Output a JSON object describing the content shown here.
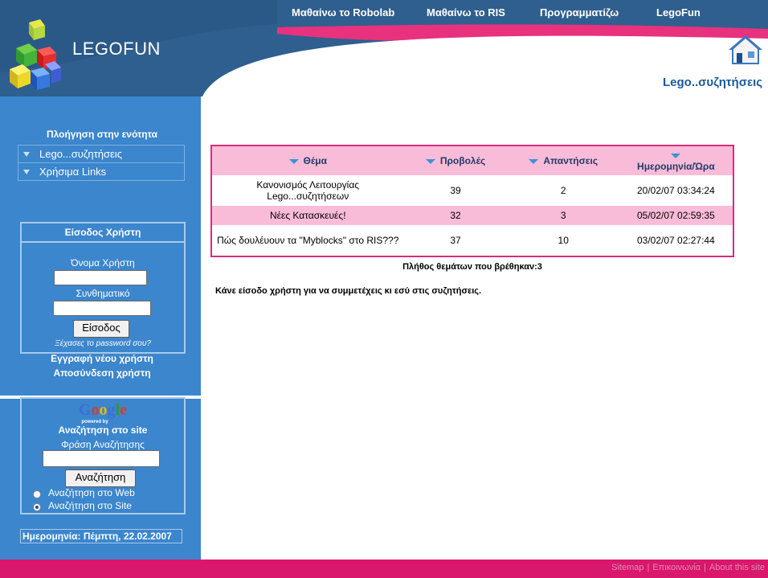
{
  "header": {
    "logo_text": "LEGOFUN",
    "nav": [
      "Μαθαίνω το Robolab",
      "Μαθαίνω το RIS",
      "Προγραμματίζω",
      "LegoFun"
    ],
    "breadcrumb": "Lego..συζητήσεις"
  },
  "sidebar": {
    "nav_title": "Πλοήγηση στην ενότητα",
    "nav_items": [
      "Lego...συζητήσεις",
      "Χρήσιμα Links"
    ],
    "login": {
      "title": "Είσοδος Χρήστη",
      "username_label": "Όνομα Χρήστη",
      "username_value": "",
      "password_label": "Συνθηματικό",
      "password_value": "",
      "submit_label": "Είσοδος",
      "forgot_link": "Ξέχασες το password σου?"
    },
    "register_link": "Εγγραφή νέου χρήστη",
    "logout_link": "Αποσύνδεση χρήστη",
    "search": {
      "logo": "Google",
      "powered_by": "powered by",
      "title": "Αναζήτηση στο site",
      "phrase_label": "Φράση Αναζήτησης",
      "phrase_value": "",
      "submit_label": "Αναζήτηση",
      "options": [
        {
          "label": "Αναζήτηση στο Web",
          "selected": false
        },
        {
          "label": "Αναζήτηση στο Site",
          "selected": true
        }
      ]
    },
    "date": {
      "label": "Ημερομηνία:",
      "value": "Πέμπτη, 22.02.2007"
    }
  },
  "main": {
    "table": {
      "headers": [
        "Θέμα",
        "Προβολές",
        "Απαντήσεις",
        "Ημερομηνία/Ώρα"
      ],
      "rows": [
        {
          "title": "Κανονισμός Λειτουργίας Lego...συζητήσεων",
          "views": "39",
          "replies": "2",
          "date": "20/02/07 03:34:24"
        },
        {
          "title": "Νέες Κατασκευές!",
          "views": "32",
          "replies": "3",
          "date": "05/02/07 02:59:35"
        },
        {
          "title": "Πώς δουλέυουν τα \"Myblocks\" στο RIS???",
          "views": "37",
          "replies": "10",
          "date": "03/02/07 02:27:44"
        }
      ]
    },
    "count_text": "Πλήθος θεμάτων που βρέθηκαν:3",
    "notice": "Κάνε είσοδο χρήστη για να συμμετέχεις κι εσύ στις συζητήσεις."
  },
  "footer": {
    "links": [
      "Sitemap",
      "Επικοινωνία",
      "About this site"
    ]
  },
  "colors": {
    "header_blue": "#2f5f8e",
    "sidebar_blue": "#3b86cd",
    "accent_pink": "#d9176c",
    "row_pink": "#f9bcd8"
  }
}
